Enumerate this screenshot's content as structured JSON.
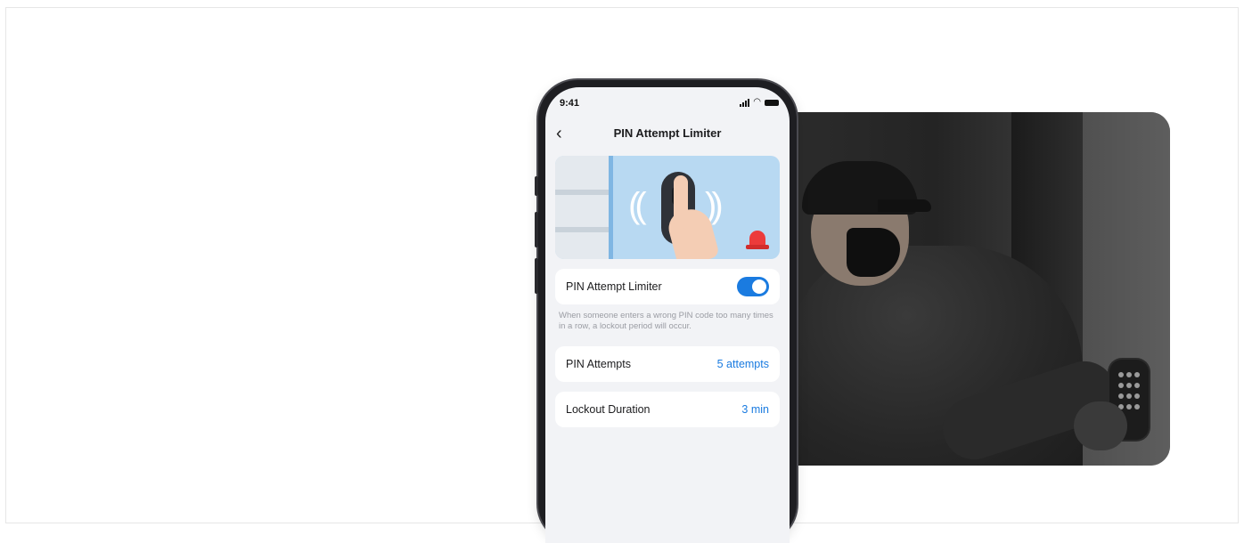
{
  "phone": {
    "status_time": "9:41",
    "nav_title": "PIN Attempt Limiter",
    "limiter_card": {
      "label": "PIN Attempt Limiter",
      "toggle_on": true
    },
    "description": "When someone enters a wrong PIN code too many times in a row, a lockout period will occur.",
    "attempts_row": {
      "label": "PIN Attempts",
      "value": "5 attempts"
    },
    "duration_row": {
      "label": "Lockout Duration",
      "value": "3 min"
    }
  },
  "colors": {
    "accent": "#1a7be0",
    "banner_bg": "#b8d9f2",
    "screen_bg": "#f2f3f6",
    "alarm": "#ec3b3b"
  },
  "icons": [
    "back-chevron-icon",
    "cellular-signal-icon",
    "wifi-icon",
    "battery-icon",
    "alarm-light-icon"
  ]
}
